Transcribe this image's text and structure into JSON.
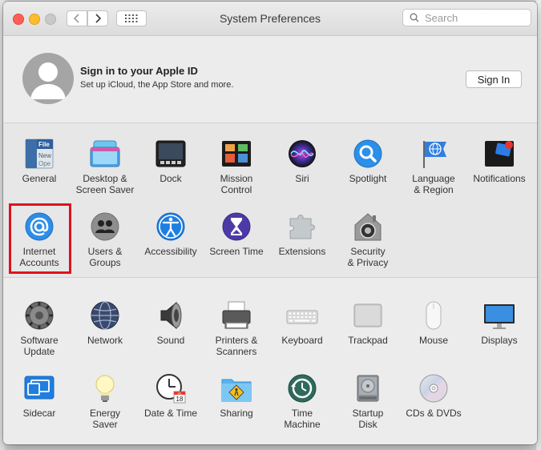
{
  "window": {
    "title": "System Preferences"
  },
  "search": {
    "placeholder": "Search"
  },
  "apple_id": {
    "title": "Sign in to your Apple ID",
    "subtitle": "Set up iCloud, the App Store and more.",
    "button": "Sign In"
  },
  "icons": {
    "general_doc": [
      "File",
      "New",
      "Ope"
    ],
    "calendar_month": "JUL",
    "calendar_day": "18"
  },
  "highlight_color": "#e0121c",
  "panes_row1": [
    {
      "label": "General",
      "icon": "general-icon"
    },
    {
      "label": "Desktop &\nScreen Saver",
      "icon": "desktop-screensaver-icon"
    },
    {
      "label": "Dock",
      "icon": "dock-icon"
    },
    {
      "label": "Mission\nControl",
      "icon": "mission-control-icon"
    },
    {
      "label": "Siri",
      "icon": "siri-icon"
    },
    {
      "label": "Spotlight",
      "icon": "spotlight-icon"
    },
    {
      "label": "Language\n& Region",
      "icon": "language-region-icon"
    },
    {
      "label": "Notifications",
      "icon": "notifications-icon"
    }
  ],
  "panes_row2": [
    {
      "label": "Internet\nAccounts",
      "icon": "internet-accounts-icon"
    },
    {
      "label": "Users &\nGroups",
      "icon": "users-groups-icon"
    },
    {
      "label": "Accessibility",
      "icon": "accessibility-icon"
    },
    {
      "label": "Screen Time",
      "icon": "screen-time-icon"
    },
    {
      "label": "Extensions",
      "icon": "extensions-icon"
    },
    {
      "label": "Security\n& Privacy",
      "icon": "security-privacy-icon"
    }
  ],
  "panes_row3": [
    {
      "label": "Software\nUpdate",
      "icon": "software-update-icon"
    },
    {
      "label": "Network",
      "icon": "network-icon"
    },
    {
      "label": "Sound",
      "icon": "sound-icon"
    },
    {
      "label": "Printers &\nScanners",
      "icon": "printers-scanners-icon"
    },
    {
      "label": "Keyboard",
      "icon": "keyboard-icon"
    },
    {
      "label": "Trackpad",
      "icon": "trackpad-icon"
    },
    {
      "label": "Mouse",
      "icon": "mouse-icon"
    },
    {
      "label": "Displays",
      "icon": "displays-icon"
    }
  ],
  "panes_row4": [
    {
      "label": "Sidecar",
      "icon": "sidecar-icon"
    },
    {
      "label": "Energy\nSaver",
      "icon": "energy-saver-icon"
    },
    {
      "label": "Date & Time",
      "icon": "date-time-icon"
    },
    {
      "label": "Sharing",
      "icon": "sharing-icon"
    },
    {
      "label": "Time\nMachine",
      "icon": "time-machine-icon"
    },
    {
      "label": "Startup\nDisk",
      "icon": "startup-disk-icon"
    },
    {
      "label": "CDs & DVDs",
      "icon": "cds-dvds-icon"
    }
  ]
}
